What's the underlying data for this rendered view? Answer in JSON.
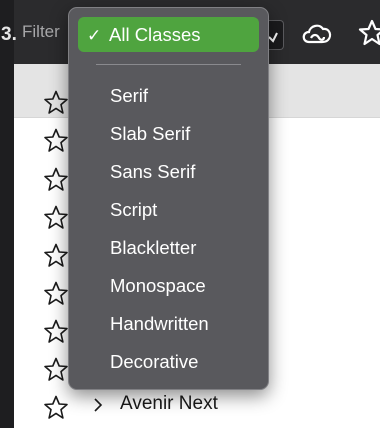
{
  "toolbar": {
    "left_edge_char": "3.",
    "filter_label": "Filter",
    "chevron_glyph": "✓",
    "creative_cloud_icon": "creative-cloud-icon",
    "favorite_icon": "star-icon"
  },
  "menu": {
    "selected_check": "✓",
    "selected_label": "All Classes",
    "items": [
      {
        "label": "Serif"
      },
      {
        "label": "Slab Serif"
      },
      {
        "label": "Sans Serif"
      },
      {
        "label": "Script"
      },
      {
        "label": "Blackletter"
      },
      {
        "label": "Monospace"
      },
      {
        "label": "Handwritten"
      },
      {
        "label": "Decorative"
      }
    ],
    "accent_color": "#4fa43f"
  },
  "font_list": {
    "visible_row_name": "Avenir Next",
    "row_count_visible": 9
  }
}
